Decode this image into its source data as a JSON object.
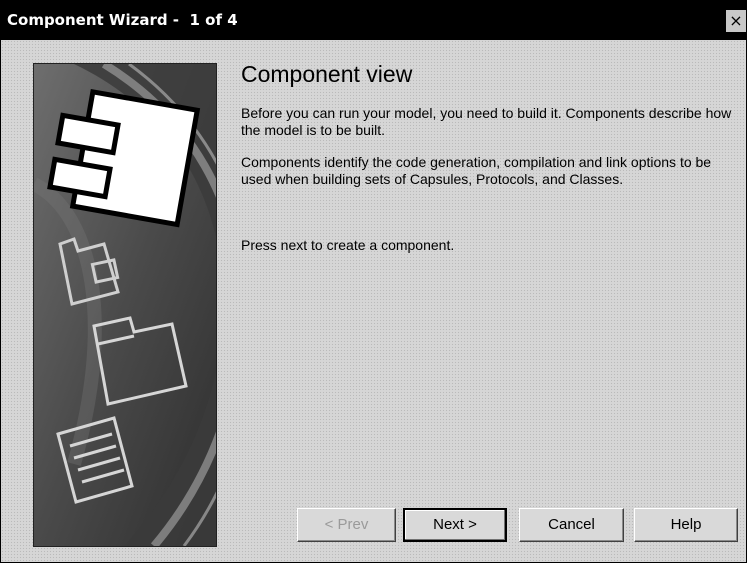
{
  "window": {
    "title": "Component Wizard -  1 of 4",
    "close_glyph": "×"
  },
  "content": {
    "heading": "Component view",
    "paragraph_1": "Before you can run your model, you need to build it.  Components describe how the model is to be built.",
    "paragraph_2": "Components identify the code generation, compilation and link options to be used when building sets of Capsules, Protocols, and Classes.",
    "paragraph_3": "Press next to create a component."
  },
  "buttons": {
    "prev": "< Prev",
    "next": "Next >",
    "cancel": "Cancel",
    "help": "Help"
  },
  "banner": {
    "icons": [
      "component-icon",
      "package-icon",
      "folder-icon",
      "document-icon"
    ]
  }
}
